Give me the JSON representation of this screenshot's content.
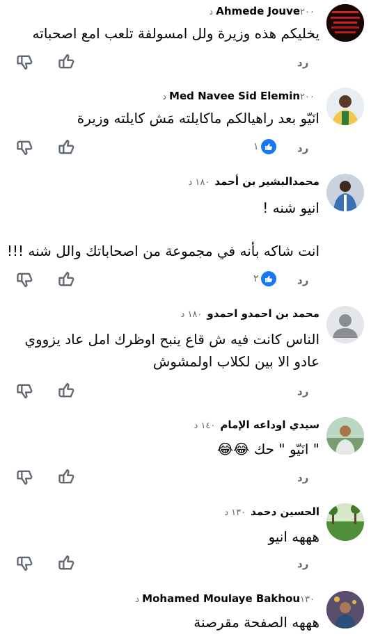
{
  "reply_label": "رد",
  "comments": [
    {
      "name": "Ahmede Jouve",
      "time": "٢٠٠ د",
      "lines": [
        "يخليكم هذه وزيرة ولل امسولفة تلعب امع اصحباته"
      ],
      "likes": ""
    },
    {
      "name": "Med Navee Sid Elemin",
      "time": "٢٠٠ د",
      "lines": [
        "انَيّو بعد راهيالكم ماكايلته مَش كايلته وزيرة"
      ],
      "likes": "١"
    },
    {
      "name": "محمدالبشير بن أحمد",
      "time": "١٨٠ د",
      "lines": [
        "انيو شنه !",
        "",
        "انت شاكه بأنه في مجموعة من اصحاباتك والل شنه !!!"
      ],
      "likes": "٢"
    },
    {
      "name": "محمد بن احمدو احمدو",
      "time": "١٨٠ د",
      "lines": [
        "الناس كانت فيه ش قاع ينبح  اوظرك امل عاد يزووي",
        "عادو الا بين لكلاب اولمشوش"
      ],
      "likes": ""
    },
    {
      "name": "سيدي اوداعه الإمام",
      "time": "١٤٠ د",
      "lines": [
        "\" انَيّو \" حك 😂😂"
      ],
      "likes": ""
    },
    {
      "name": "الحسين دحمد",
      "time": "١٣٠ د",
      "lines": [
        "هههه انيو"
      ],
      "likes": ""
    },
    {
      "name": "Mohamed Moulaye Bakhou",
      "time": "١٣٠ د",
      "lines": [
        "هههه الصفحة مقرصنة"
      ],
      "likes": ""
    }
  ]
}
